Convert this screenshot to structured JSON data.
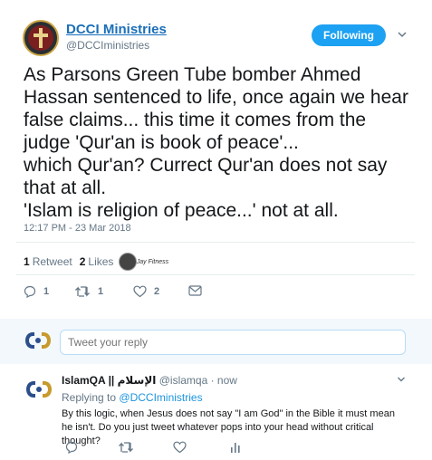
{
  "header": {
    "name": "DCCI Ministries",
    "handle": "@DCCIministries",
    "follow_label": "Following"
  },
  "tweet": {
    "text": "As Parsons Green Tube bomber Ahmed\nHassan sentenced to life, once again we hear\nfalse claims... this time  it comes from the\njudge 'Qur'an is book of peace'...\nwhich Qur'an? Currect Qur'an does not say\nthat at all.\n'Islam is religion of peace...' not at all.",
    "timestamp": "12:17 PM - 23 Mar 2018"
  },
  "stats": {
    "retweets_count": "1",
    "retweets_label": "Retweet",
    "likes_count": "2",
    "likes_label": "Likes",
    "liker2_text": "Jay Fitness"
  },
  "actions": {
    "reply_count": "1",
    "retweet_count": "1",
    "like_count": "2"
  },
  "reply_box": {
    "placeholder": "Tweet your reply"
  },
  "reply": {
    "name": "IslamQA || الإسلام",
    "handle_time": "@islamqa · now",
    "replying_prefix": "Replying to",
    "replying_to": "@DCCIministries",
    "text": "By this logic, when Jesus does not say \"I am God\" in the Bible it must mean he isn't. Do you just tweet whatever pops into your head without critical thought?"
  },
  "colors": {
    "accent": "#1da1f2",
    "link": "#1b95e0",
    "muted": "#657786",
    "text": "#14171a"
  },
  "icons": [
    "chevron-down-icon",
    "reply-icon",
    "retweet-icon",
    "heart-icon",
    "message-icon",
    "analytics-icon"
  ]
}
